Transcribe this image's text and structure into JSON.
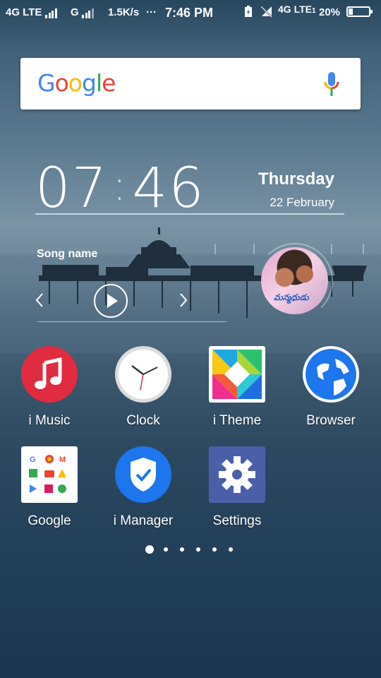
{
  "status_bar": {
    "network1": "4G LTE",
    "network2": "G",
    "speed": "1.5K/s",
    "more": "···",
    "time": "7:46 PM",
    "network3": "4G LTE",
    "sim_index": "1",
    "battery_percent": "20%",
    "battery_level": 0.2,
    "icons": [
      "signal-icon",
      "battery-saver-icon",
      "no-signal-icon"
    ]
  },
  "search": {
    "logo": "Google",
    "logo_colors": [
      "#4285F4",
      "#EA4335",
      "#FBBC05",
      "#4285F4",
      "#34A853",
      "#EA4335"
    ],
    "mic_icon": "mic-icon"
  },
  "clock_widget": {
    "hours": "07",
    "colon": ":",
    "minutes": "46",
    "day": "Thursday",
    "date": "22 February"
  },
  "music_widget": {
    "song_name": "Song name",
    "album_art_caption": "మన్మధుడు",
    "icons": [
      "previous-icon",
      "play-icon",
      "next-icon"
    ]
  },
  "apps": [
    {
      "label": "i Music",
      "icon": "music-note-icon"
    },
    {
      "label": "Clock",
      "icon": "clock-icon"
    },
    {
      "label": "i Theme",
      "icon": "theme-icon"
    },
    {
      "label": "Browser",
      "icon": "globe-icon"
    },
    {
      "label": "Google",
      "icon": "google-folder-icon"
    },
    {
      "label": "i Manager",
      "icon": "shield-check-icon"
    },
    {
      "label": "Settings",
      "icon": "gear-icon"
    }
  ],
  "page_indicator": {
    "pages": 6,
    "current": 1
  }
}
